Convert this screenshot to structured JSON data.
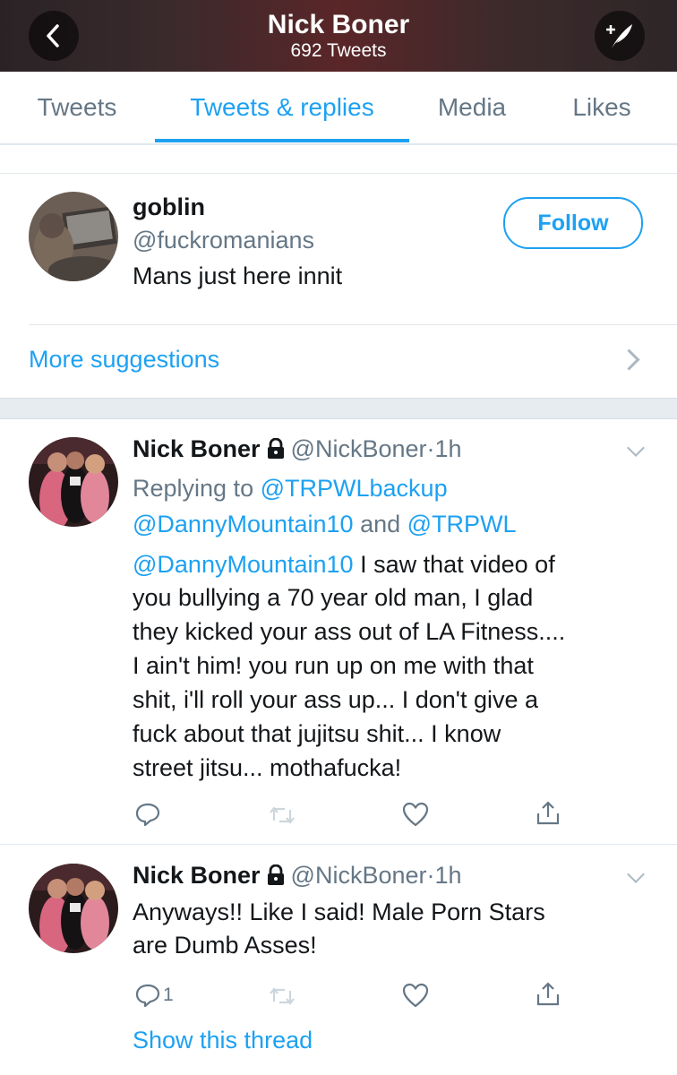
{
  "header": {
    "title": "Nick Boner",
    "subtitle": "692 Tweets",
    "back_icon": "chevron-left-icon",
    "compose_icon": "compose-tweet-icon"
  },
  "tabs": [
    {
      "label": "Tweets",
      "active": false
    },
    {
      "label": "Tweets & replies",
      "active": true
    },
    {
      "label": "Media",
      "active": false
    },
    {
      "label": "Likes",
      "active": false
    }
  ],
  "suggestion": {
    "name": "goblin",
    "handle": "@fuckromanians",
    "bio": "Mans just here innit",
    "follow_label": "Follow",
    "more_label": "More suggestions"
  },
  "tweets": [
    {
      "name": "Nick Boner",
      "handle": "@NickBoner",
      "time": "1h",
      "replying_prefix": "Replying to",
      "reply_targets": [
        "@TRPWLbackup",
        "@DannyMountain10",
        "@TRPWL"
      ],
      "reply_joiner": "and",
      "mention": "@DannyMountain10",
      "lines": [
        "I saw that video of",
        "you bullying a 70 year old man, I glad",
        "they kicked your ass out of LA Fitness....",
        "I ain't him! you run up on me with that",
        "shit, i'll roll your ass up... I don't give a",
        "fuck about that jujitsu shit...  I know",
        "street jitsu... mothafucka!"
      ],
      "reply_count": ""
    },
    {
      "name": "Nick Boner",
      "handle": "@NickBoner",
      "time": "1h",
      "lines": [
        "Anyways!! Like I said! Male Porn Stars",
        "are Dumb Asses!"
      ],
      "reply_count": "1",
      "show_thread": "Show this thread"
    }
  ],
  "colors": {
    "accent": "#1da1f2",
    "secondary_text": "#657786",
    "primary_text": "#14171a",
    "divider": "#e1e8ed"
  }
}
